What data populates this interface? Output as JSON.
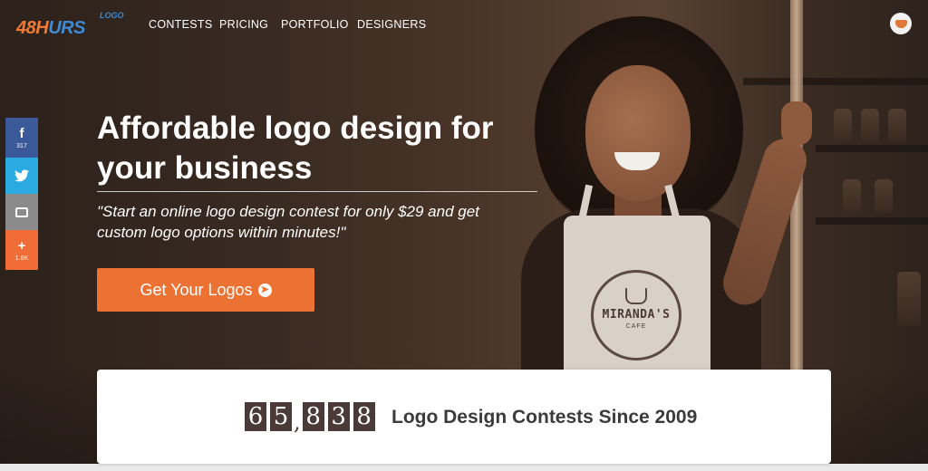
{
  "logo": {
    "text_main_a": "48H",
    "text_main_b": "URS",
    "text_tag": "LOGO"
  },
  "nav": {
    "links": [
      "CONTESTS",
      "PRICING",
      "PORTFOLIO",
      "DESIGNERS"
    ]
  },
  "hero": {
    "headline": "Affordable logo design for your business",
    "tagline": "\"Start an online logo design contest for only $29 and get custom logo options within minutes!\"",
    "cta_label": "Get Your Logos",
    "apron_text": "MIRANDA'S",
    "apron_sub": "CAFE"
  },
  "share": {
    "facebook_count": "317",
    "more_count": "1.8K"
  },
  "counter": {
    "digits": [
      "6",
      "5",
      "8",
      "3",
      "8"
    ],
    "label": "Logo Design Contests Since 2009"
  },
  "colors": {
    "accent_orange": "#ec7234",
    "logo_blue": "#3d8ad6",
    "facebook": "#3b5998",
    "twitter": "#2ba9e1",
    "print": "#8b8b8b",
    "more": "#f26c38",
    "digit_bg": "#4a3a38"
  },
  "icons": {
    "facebook": "facebook-icon",
    "twitter": "twitter-icon",
    "print": "print-icon",
    "more": "plus-icon",
    "cta": "arrow-circle-right-icon",
    "user": "user-avatar-icon"
  }
}
